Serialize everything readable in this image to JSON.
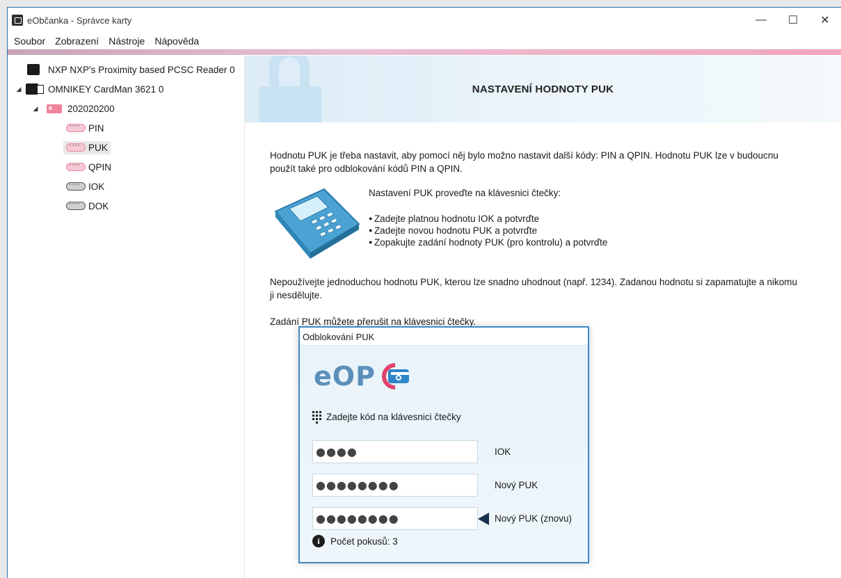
{
  "window": {
    "title": "eObčanka - Správce karty",
    "controls": {
      "minimize": "—",
      "maximize": "☐",
      "close": "✕"
    }
  },
  "menu": [
    "Soubor",
    "Zobrazení",
    "Nástroje",
    "Nápověda"
  ],
  "tree": {
    "reader1": "NXP NXP's Proximity based PCSC Reader 0",
    "reader2": "OMNIKEY CardMan 3621 0",
    "card": "202020200",
    "items": [
      "PIN",
      "PUK",
      "QPIN",
      "IOK",
      "DOK"
    ]
  },
  "header": {
    "title": "NASTAVENÍ HODNOTY PUK"
  },
  "body": {
    "intro": "Hodnotu PUK je třeba nastavit, aby pomocí něj bylo možno nastavit další kódy: PIN a QPIN. Hodnotu PUK lze v budoucnu použít také pro odblokování kódů PIN a QPIN.",
    "instr_title": "Nastavení PUK proveďte na klávesnici čtečky:",
    "steps": [
      "Zadejte platnou hodnotu IOK a potvrďte",
      "Zadejte novou hodnotu PUK a potvrďte",
      "Zopakujte zadání hodnoty PUK (pro kontrolu) a potvrďte"
    ],
    "warning": "Nepoužívejte jednoduchou hodnotu PUK, kterou lze snadno uhodnout (např. 1234). Zadanou hodnotu si zapamatujte a nikomu ji nesdělujte.",
    "cancel_note": "Zadání PUK můžete přerušit na klávesnici čtečky."
  },
  "dialog": {
    "title": "Odblokování PUK",
    "logo_text": "eOP",
    "prompt": "Zadejte kód na klávesnici čtečky",
    "fields": [
      {
        "value": "●●●●",
        "label": "IOK"
      },
      {
        "value": "●●●●●●●●",
        "label": "Nový PUK"
      },
      {
        "value": "●●●●●●●●",
        "label": "Nový PUK (znovu)"
      }
    ],
    "attempts": "Počet pokusů: 3"
  },
  "colors": {
    "accent_pink": "#e0436b",
    "logo_blue": "#5b8fb9",
    "dialog_border": "#3f88c5"
  }
}
